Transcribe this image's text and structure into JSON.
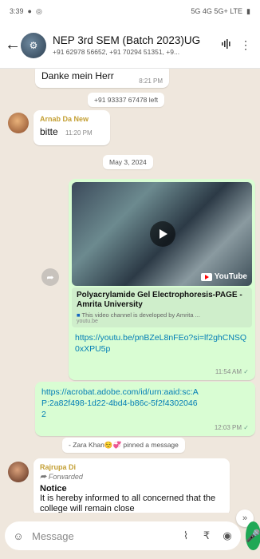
{
  "status_bar": {
    "time": "3:39",
    "network": "5G 4G 5G+ LTE"
  },
  "header": {
    "group_name": "NEP 3rd SEM (Batch 2023)UG",
    "members": "+91 62978 56652, +91 70294 51351, +9..."
  },
  "messages": {
    "danke": {
      "text": "Danke mein Herr",
      "time": "8:21 PM"
    },
    "left_notice": "+91 93337 67478 left",
    "bitte": {
      "sender": "Arnab Da New",
      "text": "bitte",
      "time": "11:20 PM"
    },
    "date_divider": "May 3, 2024",
    "youtube": {
      "badge": "YouTube",
      "preview_title": "Polyacrylamide Gel Electrophoresis-PAGE - Amrita University",
      "preview_desc": "This video channel is developed by Amrita ...",
      "preview_domain": "youtu.be",
      "url": "https://youtu.be/pnBZeL8nFEo?si=lf2ghCNSQ0xXPU5p",
      "time": "11:54 AM"
    },
    "adobe": {
      "url": "https://acrobat.adobe.com/id/urn:aaid:sc:AP:2a82f498-1d22-4bd4-b86c-5f2f43020462",
      "time": "12:03 PM"
    },
    "pinned_notice": "- Zara Khan☺️💞 pinned a message",
    "notice_msg": {
      "sender": "Rajrupa Di",
      "forwarded": "Forwarded",
      "title": "Notice",
      "body": "It is hereby informed to all concerned that the college will remain close"
    }
  },
  "input": {
    "placeholder": "Message"
  },
  "colors": {
    "chat_bg": "#efe7dd",
    "outgoing": "#d9fdd3",
    "link": "#027eb5",
    "accent": "#1fa855"
  }
}
